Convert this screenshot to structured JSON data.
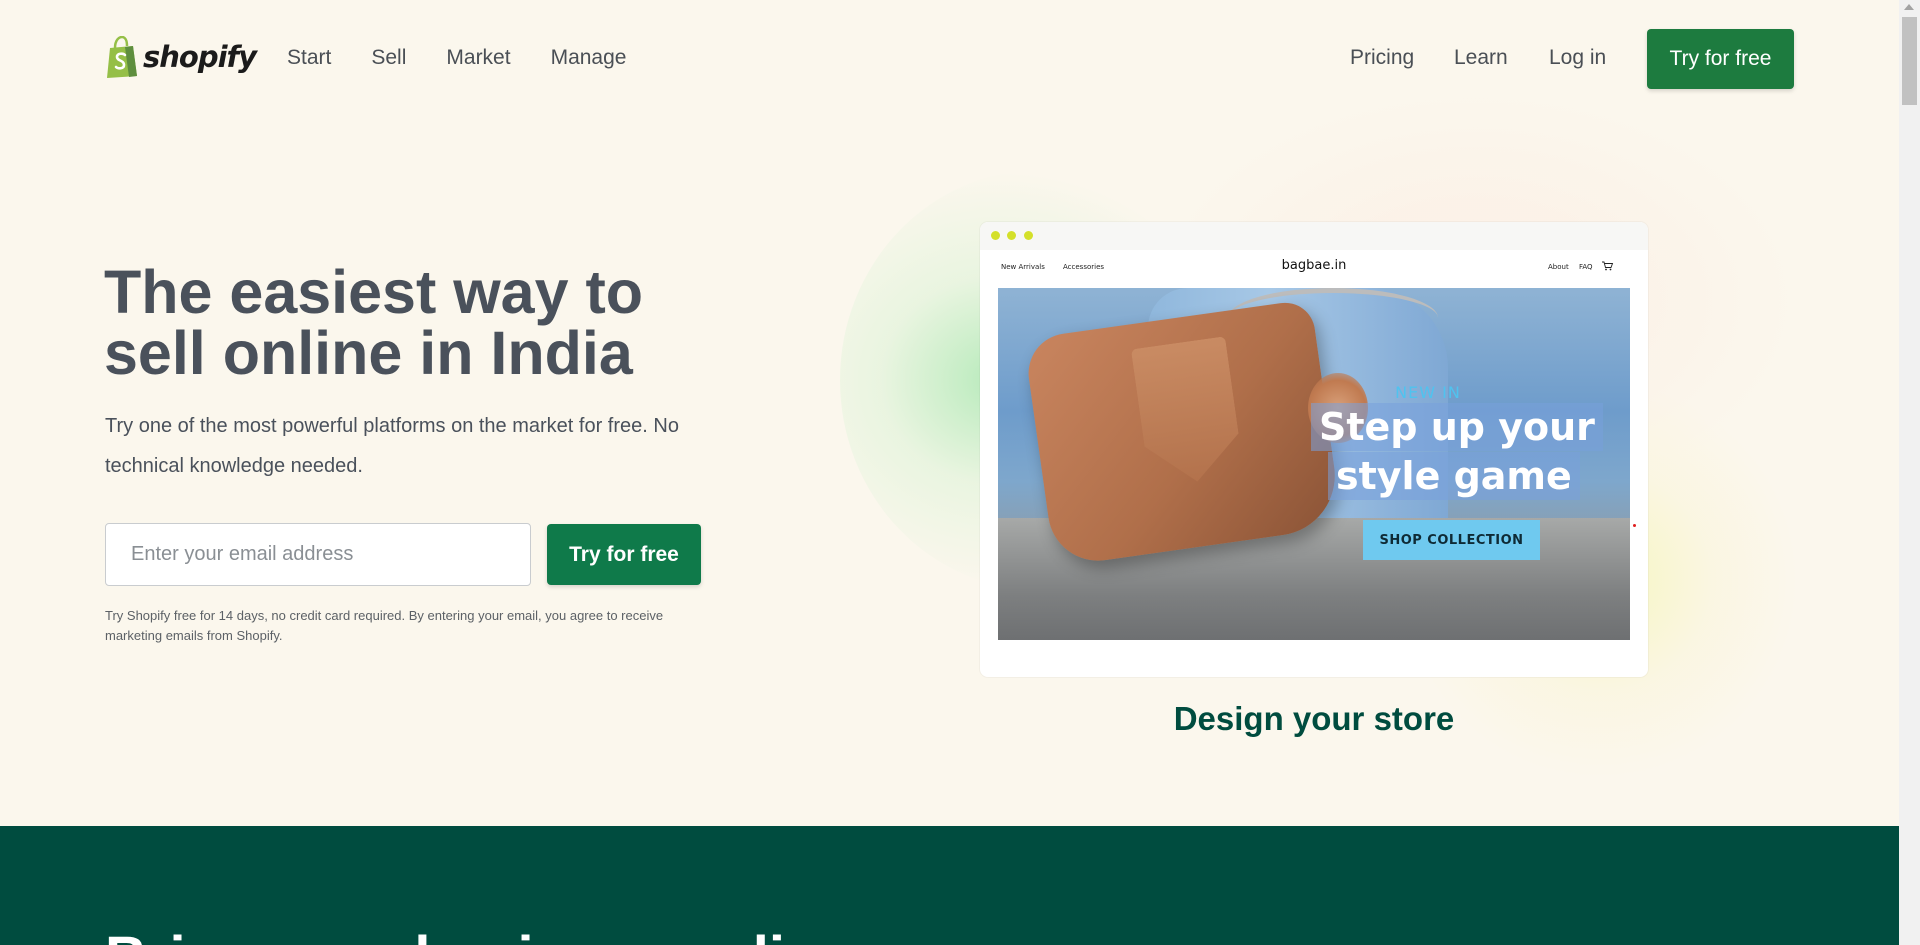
{
  "header": {
    "brand": "shopify",
    "nav_left": [
      "Start",
      "Sell",
      "Market",
      "Manage"
    ],
    "pricing": "Pricing",
    "learn": "Learn",
    "login": "Log in",
    "cta": "Try for free"
  },
  "hero": {
    "title": "The easiest way to sell online in India",
    "subtitle": "Try one of the most powerful platforms on the market for free. No technical knowledge needed.",
    "email_placeholder": "Enter your email address",
    "email_value": "",
    "cta": "Try for free",
    "disclaimer": "Try Shopify free for 14 days, no credit card required. By entering your email, you agree to receive marketing emails from Shopify."
  },
  "mockup": {
    "nav_new_arrivals": "New Arrivals",
    "nav_accessories": "Accessories",
    "brand": "bagbae.in",
    "nav_about": "About",
    "nav_faq": "FAQ",
    "eyebrow": "NEW IN",
    "headline_line1": "Step up your",
    "headline_line2": "style game",
    "button": "SHOP COLLECTION",
    "caption": "Design your store"
  },
  "dark_section": {
    "heading": "Bring your business online"
  },
  "colors": {
    "background": "#fbf7ed",
    "primary_green": "#1d7b3f",
    "dark_green": "#004c3f",
    "text_gray": "#4a515b"
  }
}
